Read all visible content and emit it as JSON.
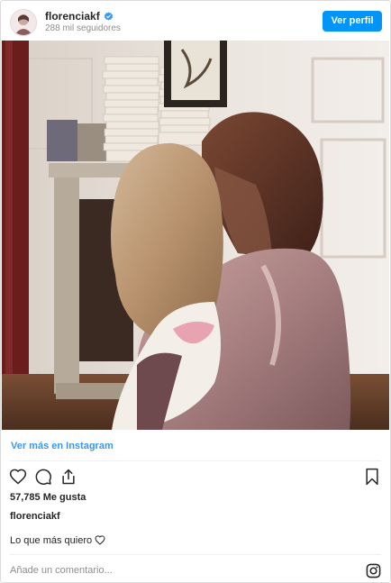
{
  "header": {
    "username": "florenciakf",
    "followers": "288 mil seguidores",
    "profile_button": "Ver perfil"
  },
  "post": {
    "image_description": "photo",
    "view_more": "Ver más en Instagram",
    "likes": "57,785 Me gusta",
    "owner": "florenciakf",
    "caption": "Lo que más quiero"
  },
  "comment": {
    "placeholder": "Añade un comentario..."
  },
  "colors": {
    "accent": "#0095f6",
    "link": "#3897f0",
    "verified": "#3897f0",
    "muted": "#8e8e8e"
  },
  "icons": {
    "like": "heart-icon",
    "comment": "comment-icon",
    "share": "share-icon",
    "save": "bookmark-icon",
    "caption_heart": "heart-outline-icon",
    "instagram": "instagram-logo-icon",
    "verified": "verified-badge-icon"
  }
}
